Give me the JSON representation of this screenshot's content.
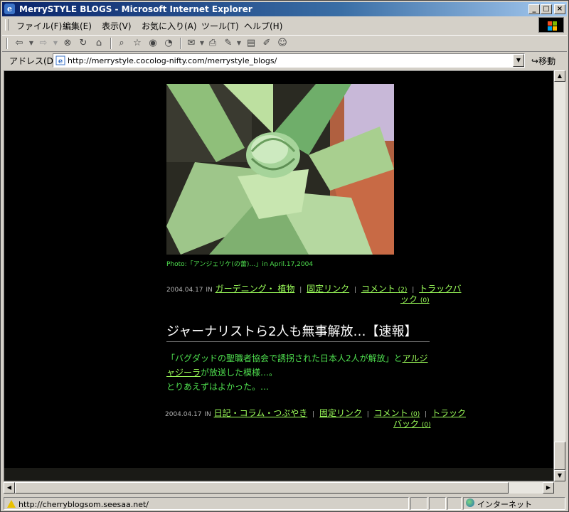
{
  "window": {
    "title": "MerrySTYLE BLOGS - Microsoft Internet Explorer",
    "minimize_glyph": "_",
    "maximize_glyph": "□",
    "close_glyph": "×"
  },
  "menu": [
    "ファイル(F)",
    "編集(E)",
    "表示(V)",
    "お気に入り(A)",
    "ツール(T)",
    "ヘルプ(H)"
  ],
  "toolbar_icons": [
    "back-icon",
    "forward-icon",
    "stop-icon",
    "refresh-icon",
    "home-icon",
    "search-icon",
    "favorites-icon",
    "history-icon",
    "media-icon",
    "mail-icon",
    "print-icon",
    "edit-icon",
    "discuss-icon",
    "messenger-icon"
  ],
  "address": {
    "label": "アドレス(D)",
    "url": "http://merrystyle.cocolog-nifty.com/merrystyle_blogs/",
    "go_label": "移動"
  },
  "post1": {
    "photo_caption": "Photo:「アンジェリケ(の蕾)…」in April.17,2004",
    "date": "2004.04.17",
    "in_label": "IN",
    "category": "ガーデニング・ 植物",
    "permalink": "固定リンク",
    "comments_label": "コメント",
    "comments_count": "(2)",
    "trackback_label_1": "トラックバ",
    "trackback_label_2": "ック",
    "trackback_count": "(0)"
  },
  "post2": {
    "title": "ジャーナリストら2人も無事解放…【速報】",
    "text_1": "「バグダッドの聖職者協会で誘拐された日本人2人が解放」と",
    "link": "アルジャジーラ",
    "text_2": "が放送した模様…。",
    "text_3": "とりあえずはよかった。…",
    "date": "2004.04.17",
    "in_label": "IN",
    "category": "日記・コラム・つぶやき",
    "permalink": "固定リンク",
    "comments_label": "コメント",
    "comments_count": "(0)",
    "trackback_label_1": "トラック",
    "trackback_label_2": "バック",
    "trackback_count": "(0)"
  },
  "status": {
    "text": "http://cherryblogsom.seesaa.net/",
    "zone": "インターネット"
  },
  "colors": {
    "page_background": "#000000",
    "link_green": "#9cff5a",
    "text_green": "#4fe04f",
    "title_white": "#ffffff",
    "chrome_gray": "#d4d0c8",
    "titlebar_blue": "#0a246a"
  }
}
